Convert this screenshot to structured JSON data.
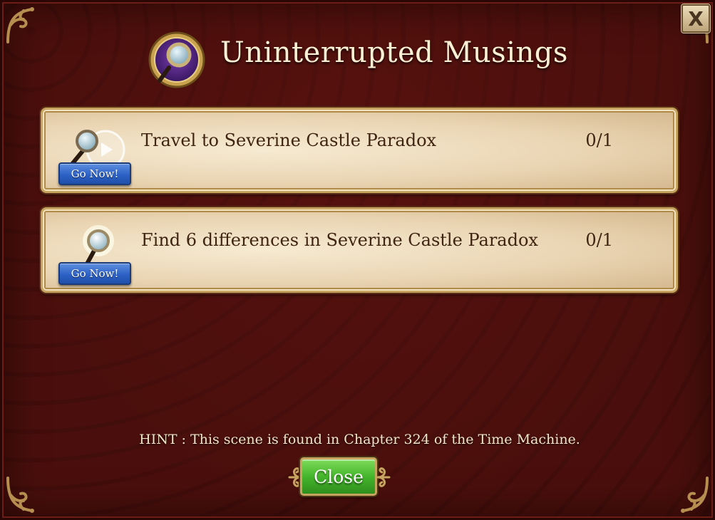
{
  "dialog": {
    "title": "Uninterrupted Musings",
    "close_x_label": "X",
    "header_icon": "magnifying-glass-icon"
  },
  "tasks": [
    {
      "text": "Travel to Severine Castle Paradox",
      "progress": "0/1",
      "button_label": "Go Now!",
      "icon": "magnifying-glass-play-icon"
    },
    {
      "text": "Find 6 differences in Severine Castle Paradox",
      "progress": "0/1",
      "button_label": "Go Now!",
      "icon": "magnifying-glass-icon"
    }
  ],
  "hint": "HINT : This scene is found in Chapter 324 of the Time Machine.",
  "footer": {
    "close_label": "Close"
  },
  "colors": {
    "background": "#4a0f0c",
    "card": "#ead5b3",
    "gold_trim": "#c7a560",
    "go_button": "#2d61c6",
    "close_button": "#44b52c",
    "title_text": "#fbf0d3",
    "task_text": "#3f2412"
  }
}
